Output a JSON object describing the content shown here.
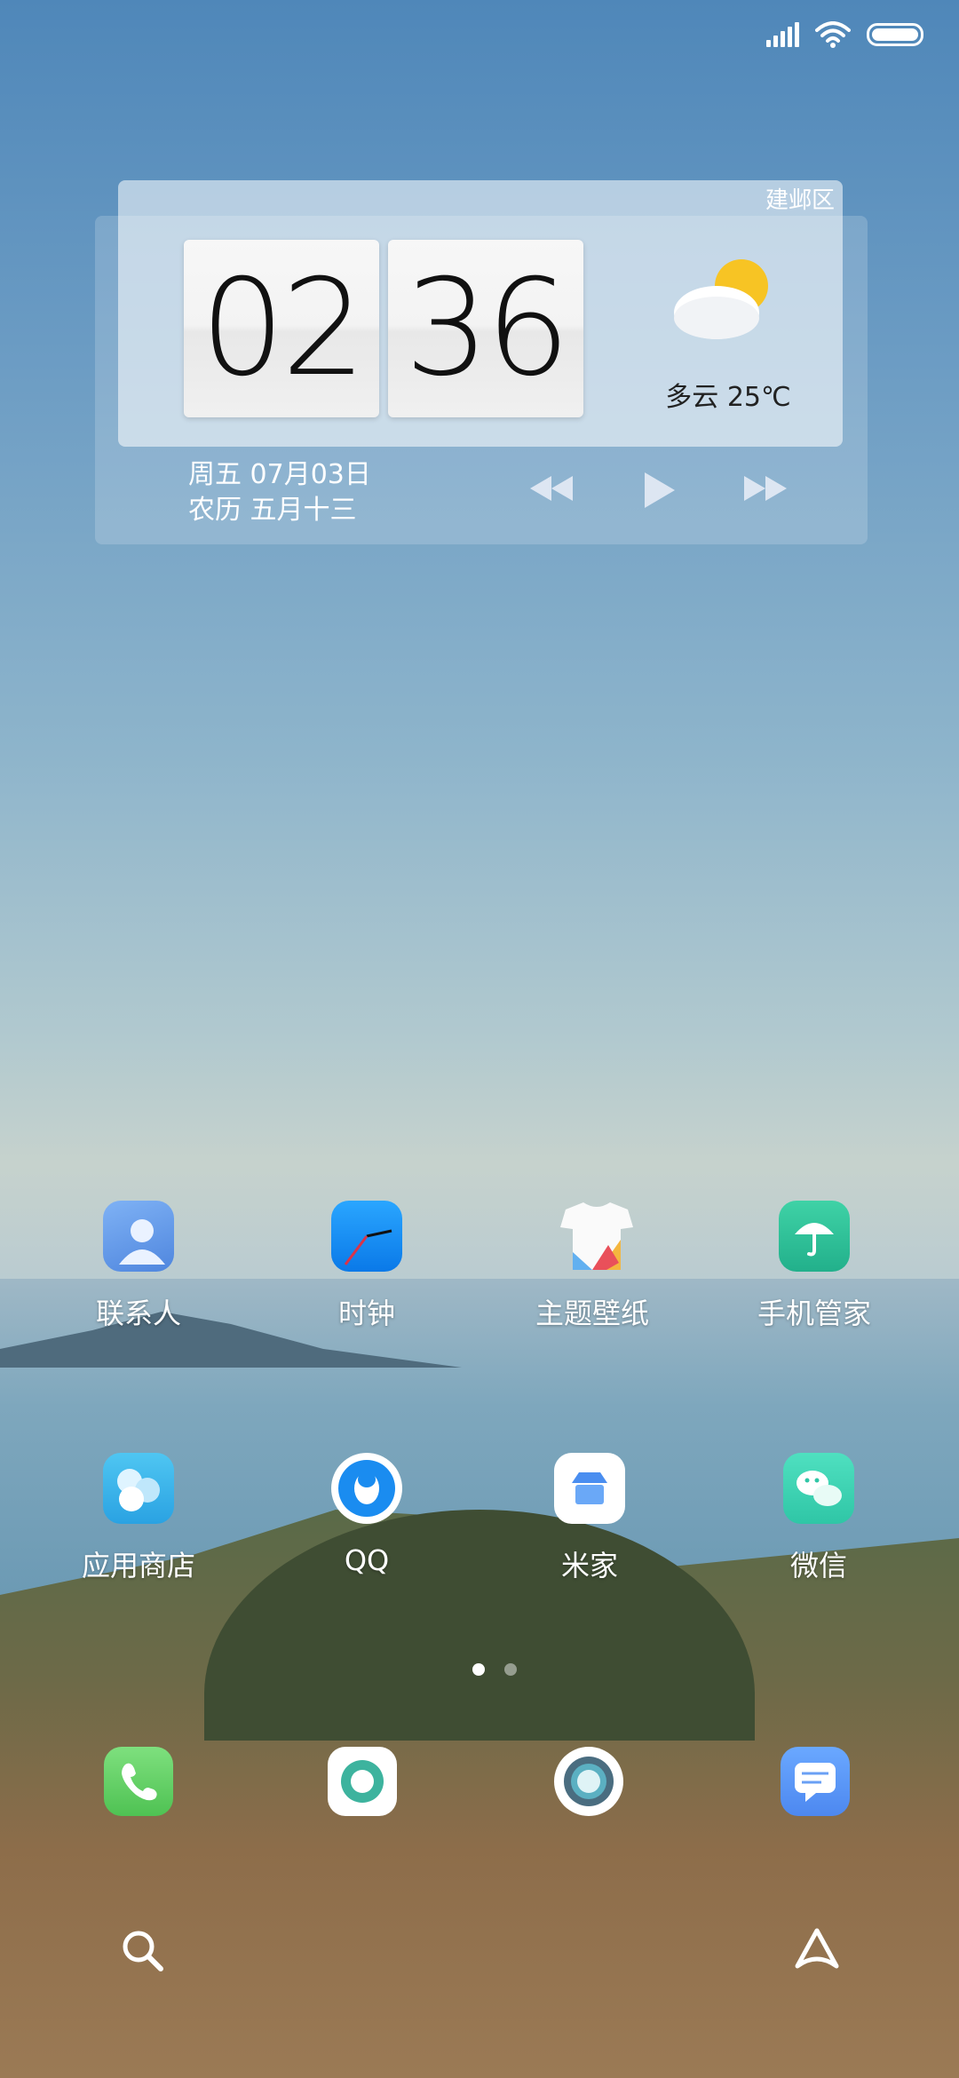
{
  "widget": {
    "district": "建邺区",
    "hour": "02",
    "minute": "36",
    "weather": "多云  25℃",
    "date_line1": "周五 07月03日",
    "date_line2": "农历 五月十三",
    "media_icons": [
      "rewind-icon",
      "play-icon",
      "fast-forward-icon"
    ]
  },
  "apps_row1": [
    {
      "label": "联系人",
      "icon": "contacts-icon",
      "color": "#6aa3f0"
    },
    {
      "label": "时钟",
      "icon": "clock-icon",
      "color": "#1c8ff5"
    },
    {
      "label": "主题壁纸",
      "icon": "themes-icon",
      "color": "#ffffff"
    },
    {
      "label": "手机管家",
      "icon": "security-icon",
      "color": "#34c39a"
    }
  ],
  "apps_row2": [
    {
      "label": "应用商店",
      "icon": "app-store-icon",
      "color": "#40b8ea"
    },
    {
      "label": "QQ",
      "icon": "qq-icon",
      "color": "#1a8cf0"
    },
    {
      "label": "米家",
      "icon": "mijia-icon",
      "color": "#ffffff"
    },
    {
      "label": "微信",
      "icon": "wechat-icon",
      "color": "#3fd7b8"
    }
  ],
  "dock": [
    "phone-icon",
    "browser-icon",
    "camera-icon",
    "messages-icon"
  ],
  "bottom": [
    "search-icon",
    "assistant-icon"
  ],
  "page_indicator": {
    "current": 1,
    "total": 2
  }
}
